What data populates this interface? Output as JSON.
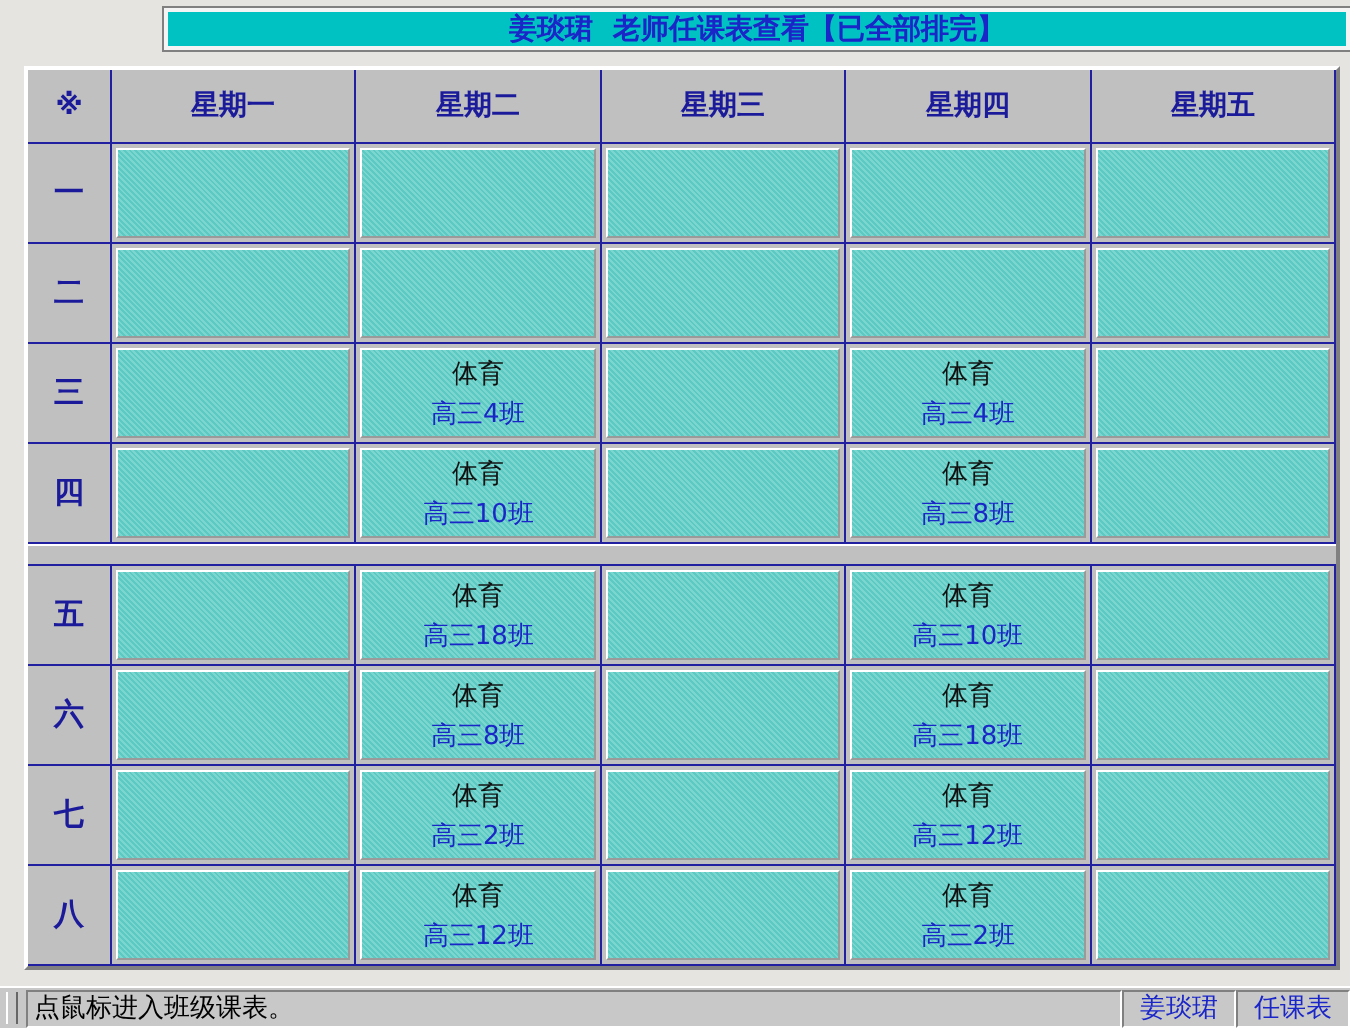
{
  "title": "姜琰珺  老师任课表查看【已全部排完】",
  "table": {
    "corner": "※",
    "columns": [
      "星期一",
      "星期二",
      "星期三",
      "星期四",
      "星期五"
    ],
    "rows": [
      {
        "kind": "period",
        "label": "一",
        "cells": [
          null,
          null,
          null,
          null,
          null
        ]
      },
      {
        "kind": "period",
        "label": "二",
        "cells": [
          null,
          null,
          null,
          null,
          null
        ]
      },
      {
        "kind": "period",
        "label": "三",
        "cells": [
          null,
          {
            "subject": "体育",
            "class": "高三4班"
          },
          null,
          {
            "subject": "体育",
            "class": "高三4班"
          },
          null
        ]
      },
      {
        "kind": "period",
        "label": "四",
        "cells": [
          null,
          {
            "subject": "体育",
            "class": "高三10班"
          },
          null,
          {
            "subject": "体育",
            "class": "高三8班"
          },
          null
        ]
      },
      {
        "kind": "break"
      },
      {
        "kind": "period",
        "label": "五",
        "cells": [
          null,
          {
            "subject": "体育",
            "class": "高三18班"
          },
          null,
          {
            "subject": "体育",
            "class": "高三10班"
          },
          null
        ]
      },
      {
        "kind": "period",
        "label": "六",
        "cells": [
          null,
          {
            "subject": "体育",
            "class": "高三8班"
          },
          null,
          {
            "subject": "体育",
            "class": "高三18班"
          },
          null
        ]
      },
      {
        "kind": "period",
        "label": "七",
        "cells": [
          null,
          {
            "subject": "体育",
            "class": "高三2班"
          },
          null,
          {
            "subject": "体育",
            "class": "高三12班"
          },
          null
        ]
      },
      {
        "kind": "period",
        "label": "八",
        "cells": [
          null,
          {
            "subject": "体育",
            "class": "高三12班"
          },
          null,
          {
            "subject": "体育",
            "class": "高三2班"
          },
          null
        ]
      }
    ]
  },
  "status_bar": {
    "message": "点鼠标进入班级课表。",
    "teacher": "姜琰珺",
    "view": "任课表"
  }
}
